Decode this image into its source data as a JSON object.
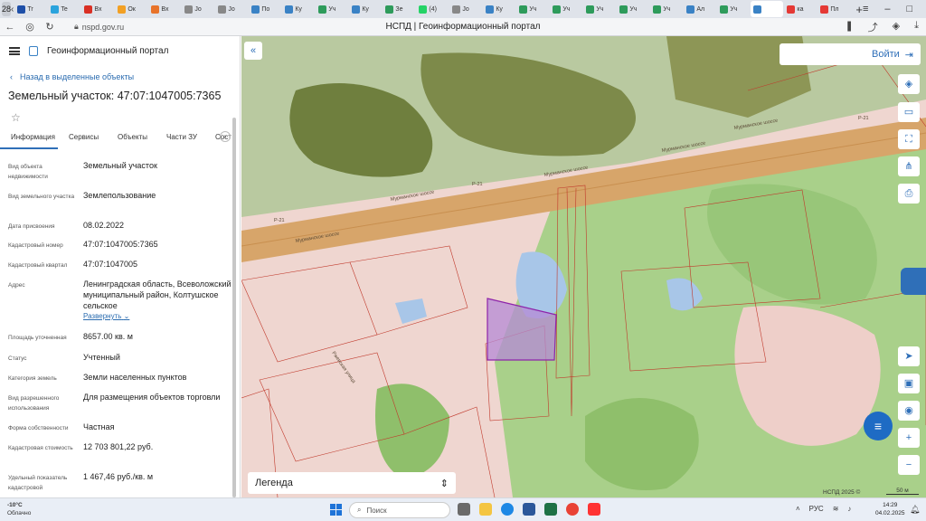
{
  "browser": {
    "tab_count": "28",
    "tabs": [
      {
        "label": "Tr",
        "color": "#1e4fa8"
      },
      {
        "label": "Te",
        "color": "#2aa3dd"
      },
      {
        "label": "Вх",
        "color": "#d93025"
      },
      {
        "label": "Ок",
        "color": "#f2a024"
      },
      {
        "label": "Вх",
        "color": "#e8732a"
      },
      {
        "label": "Jo",
        "color": "#888888"
      },
      {
        "label": "Jo",
        "color": "#888888"
      },
      {
        "label": "По",
        "color": "#3a82c5"
      },
      {
        "label": "Ку",
        "color": "#3a82c5"
      },
      {
        "label": "Уч",
        "color": "#2e9b5b"
      },
      {
        "label": "Ку",
        "color": "#3a82c5"
      },
      {
        "label": "Зе",
        "color": "#2e9b5b"
      },
      {
        "label": "(4)",
        "color": "#25d366"
      },
      {
        "label": "Jo",
        "color": "#888888"
      },
      {
        "label": "Ку",
        "color": "#3a82c5"
      },
      {
        "label": "Уч",
        "color": "#2e9b5b"
      },
      {
        "label": "Уч",
        "color": "#2e9b5b"
      },
      {
        "label": "Уч",
        "color": "#2e9b5b"
      },
      {
        "label": "Уч",
        "color": "#2e9b5b"
      },
      {
        "label": "Уч",
        "color": "#2e9b5b"
      },
      {
        "label": "Ал",
        "color": "#3a82c5"
      },
      {
        "label": "Уч",
        "color": "#2e9b5b"
      },
      {
        "label": "",
        "color": "#3a82c5"
      },
      {
        "label": "ка",
        "color": "#e53935"
      },
      {
        "label": "Пл",
        "color": "#e53935"
      }
    ],
    "url": "nspd.gov.ru",
    "page_title": "НСПД | Геоинформационный портал"
  },
  "sidebar": {
    "portal_name": "Геоинформационный портал",
    "back_link": "Назад в выделенные объекты",
    "object_title": "Земельный участок: 47:07:1047005:7365",
    "tabs": [
      "Информация",
      "Сервисы",
      "Объекты",
      "Части ЗУ",
      "Соста"
    ],
    "properties": [
      {
        "label": "Вид объекта недвижимости",
        "value": "Земельный участок"
      },
      {
        "label": "Вид земельного участка",
        "value": "Землепользование"
      },
      {
        "label": "Дата присвоения",
        "value": "08.02.2022"
      },
      {
        "label": "Кадастровый номер",
        "value": "47:07:1047005:7365"
      },
      {
        "label": "Кадастровый квартал",
        "value": "47:07:1047005"
      },
      {
        "label": "Адрес",
        "value": "Ленинградская область, Всеволожский муниципальный район, Колтушское сельское"
      },
      {
        "label": "Площадь уточненная",
        "value": "8657.00 кв. м"
      },
      {
        "label": "Статус",
        "value": "Учтенный"
      },
      {
        "label": "Категория земель",
        "value": "Земли населенных пунктов"
      },
      {
        "label": "Вид разрешенного использования",
        "value": "Для размещения объектов торговли"
      },
      {
        "label": "Форма собственности",
        "value": "Частная"
      },
      {
        "label": "Кадастровая стоимость",
        "value": "12 703 801,22 руб."
      },
      {
        "label": "Удельный показатель кадастровой",
        "value": "1 467,46 руб./кв. м"
      }
    ],
    "expand_label": "Развернуть"
  },
  "map": {
    "login_label": "Войти",
    "legend_label": "Легенда",
    "road_labels": [
      "Мурманское шоссе",
      "Мурманское шоссе",
      "Мурманское шоссе",
      "Мурманское шоссе",
      "Мурманское шоссе"
    ],
    "route_badges": [
      "Р-21",
      "Р-21",
      "Р-21"
    ],
    "street_label": "Ржевская улица",
    "copyright": "НСПД 2025 ©",
    "scale": "50 м"
  },
  "taskbar": {
    "temperature": "-10°C",
    "weather": "Облачно",
    "search_placeholder": "Поиск",
    "language": "РУС",
    "time": "14:29",
    "date": "04.02.2025"
  }
}
